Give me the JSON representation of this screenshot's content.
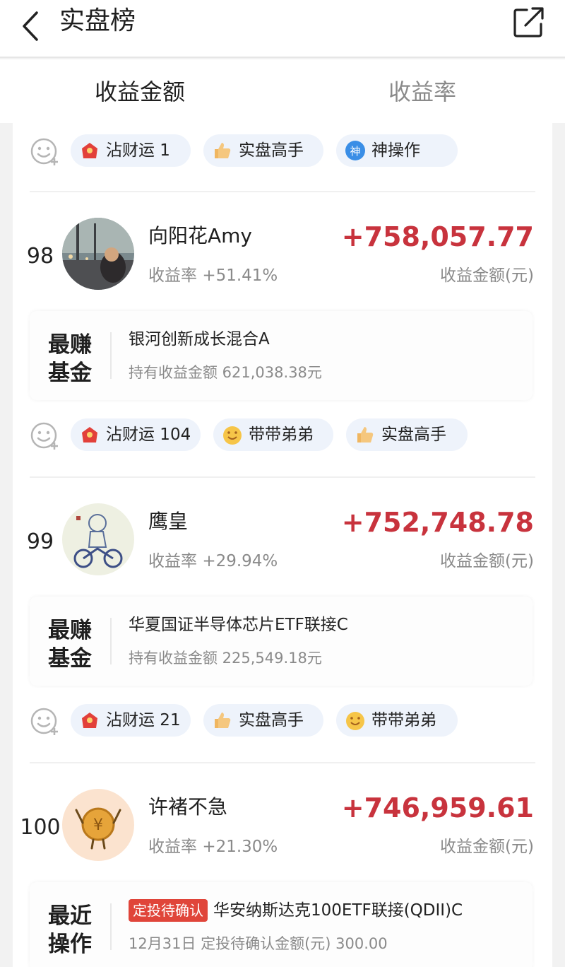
{
  "header": {
    "title": "实盘榜",
    "back_icon": "back-arrow-icon",
    "share_icon": "share-icon"
  },
  "tabs": [
    {
      "label": "收益金额",
      "active": true
    },
    {
      "label": "收益率",
      "active": false
    }
  ],
  "top_tags": [
    {
      "icon": "red-envelope-icon",
      "label": "沾财运 1"
    },
    {
      "icon": "thumbs-up-icon",
      "label": "实盘高手"
    },
    {
      "icon": "shen-badge-icon",
      "label": "神操作"
    }
  ],
  "entries": [
    {
      "rank": "98",
      "name": "向阳花Amy",
      "rate_label": "收益率",
      "rate": "+51.41%",
      "amount": "+758,057.77",
      "amount_label": "收益金额(元)",
      "fund_label_1": "最赚",
      "fund_label_2": "基金",
      "fund_name": "银河创新成长混合A",
      "fund_sub": "持有收益金额 621,038.38元",
      "tags": [
        {
          "icon": "red-envelope-icon",
          "label": "沾财运 104"
        },
        {
          "icon": "smile-face-icon",
          "label": "带带弟弟"
        },
        {
          "icon": "thumbs-up-icon",
          "label": "实盘高手"
        }
      ]
    },
    {
      "rank": "99",
      "name": "鹰皇",
      "rate_label": "收益率",
      "rate": "+29.94%",
      "amount": "+752,748.78",
      "amount_label": "收益金额(元)",
      "fund_label_1": "最赚",
      "fund_label_2": "基金",
      "fund_name": "华夏国证半导体芯片ETF联接C",
      "fund_sub": "持有收益金额 225,549.18元",
      "tags": [
        {
          "icon": "red-envelope-icon",
          "label": "沾财运 21"
        },
        {
          "icon": "thumbs-up-icon",
          "label": "实盘高手"
        },
        {
          "icon": "smile-face-icon",
          "label": "带带弟弟"
        }
      ]
    },
    {
      "rank": "100",
      "name": "许褚不急",
      "rate_label": "收益率",
      "rate": "+21.30%",
      "amount": "+746,959.61",
      "amount_label": "收益金额(元)",
      "fund_label_1": "最近",
      "fund_label_2": "操作",
      "badge": "定投待确认",
      "fund_name": "华安纳斯达克100ETF联接(QDII)C",
      "fund_sub": "12月31日 定投待确认金额(元) 300.00"
    }
  ],
  "colors": {
    "accent_red": "#c8333d",
    "tag_bg": "#eef3fb",
    "badge_red": "#e0453a"
  }
}
